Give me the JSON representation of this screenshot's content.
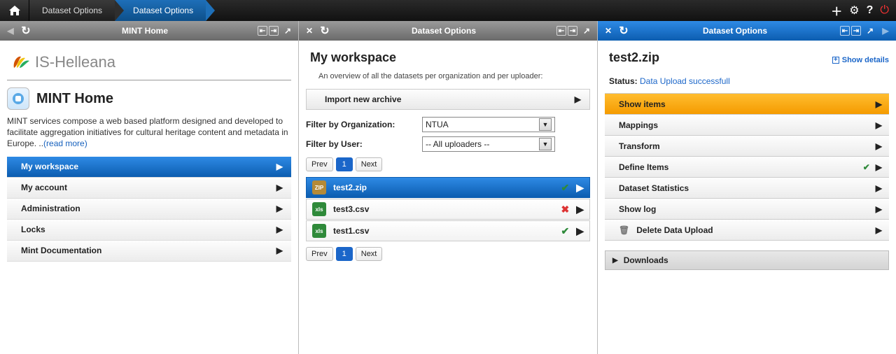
{
  "breadcrumbs": [
    "Dataset Options",
    "Dataset Options"
  ],
  "panels": {
    "left": {
      "title": "MINT Home"
    },
    "mid": {
      "title": "Dataset Options"
    },
    "right": {
      "title": "Dataset Options"
    }
  },
  "brand": "IS-Helleana",
  "mint": {
    "title": "MINT Home",
    "desc": "MINT services compose a web based platform designed and developed to facilitate aggregation initiatives for cultural heritage content and metadata in Europe. ..",
    "readmore": "(read more)"
  },
  "nav": [
    {
      "label": "My workspace",
      "selected": true
    },
    {
      "label": "My account",
      "selected": false
    },
    {
      "label": "Administration",
      "selected": false
    },
    {
      "label": "Locks",
      "selected": false
    },
    {
      "label": "Mint Documentation",
      "selected": false
    }
  ],
  "workspace": {
    "heading": "My workspace",
    "sub": "An overview of all the datasets per organization and per uploader:",
    "import": "Import new archive",
    "filter_org_label": "Filter by Organization:",
    "filter_org_value": "NTUA",
    "filter_user_label": "Filter by User:",
    "filter_user_value": "-- All uploaders --",
    "pager": {
      "prev": "Prev",
      "page": "1",
      "next": "Next"
    },
    "files": [
      {
        "name": "test2.zip",
        "type": "zip",
        "status": "ok",
        "selected": true
      },
      {
        "name": "test3.csv",
        "type": "csv",
        "status": "err",
        "selected": false
      },
      {
        "name": "test1.csv",
        "type": "csv",
        "status": "ok",
        "selected": false
      }
    ]
  },
  "dataset": {
    "title": "test2.zip",
    "show_details": "Show details",
    "status_label": "Status:",
    "status_value": "Data Upload successfull",
    "options": [
      {
        "label": "Show items",
        "selected": true,
        "icon": "",
        "check": false
      },
      {
        "label": "Mappings",
        "selected": false,
        "icon": "",
        "check": false
      },
      {
        "label": "Transform",
        "selected": false,
        "icon": "",
        "check": false
      },
      {
        "label": "Define Items",
        "selected": false,
        "icon": "",
        "check": true
      },
      {
        "label": "Dataset Statistics",
        "selected": false,
        "icon": "",
        "check": false
      },
      {
        "label": "Show log",
        "selected": false,
        "icon": "",
        "check": false
      },
      {
        "label": "Delete Data Upload",
        "selected": false,
        "icon": "trash",
        "check": false
      }
    ],
    "downloads": "Downloads"
  }
}
